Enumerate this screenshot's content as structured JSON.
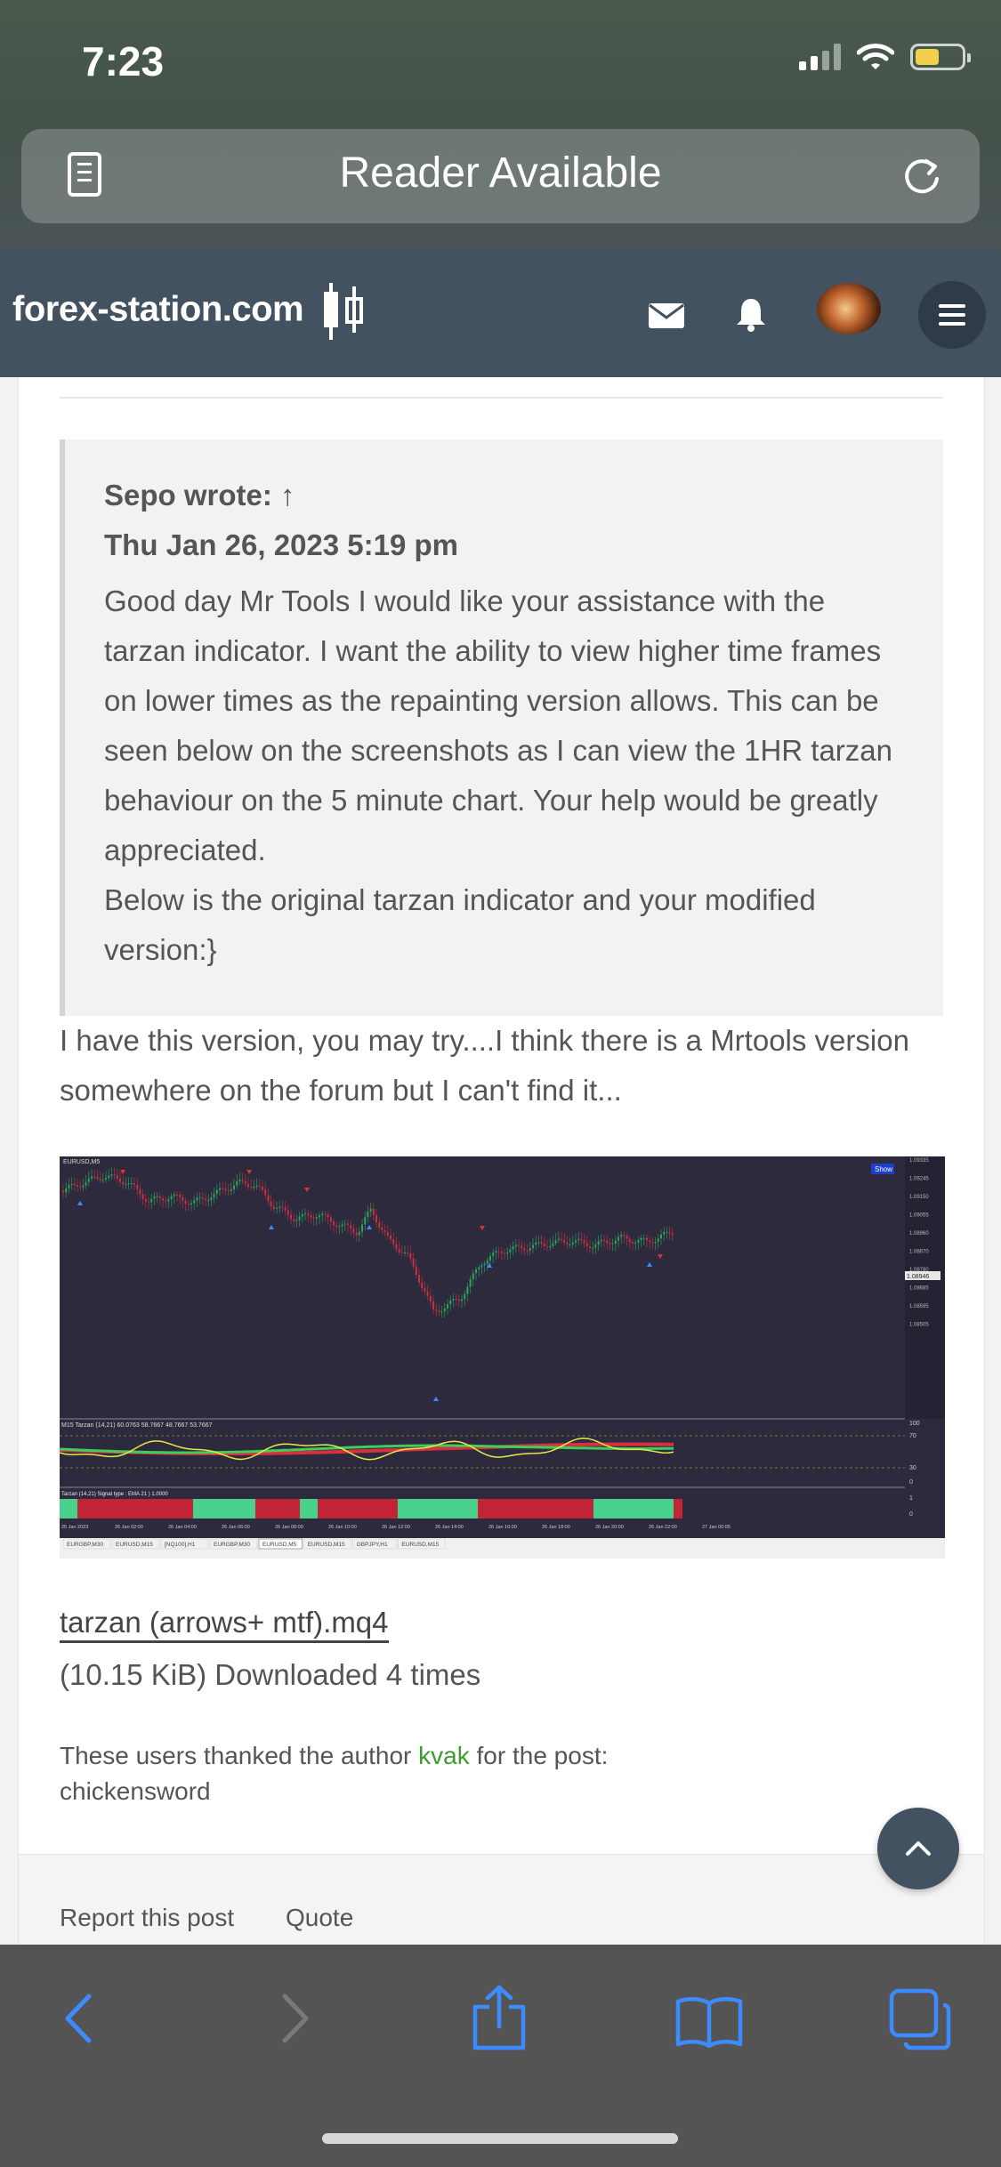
{
  "status_bar": {
    "time": "7:23"
  },
  "browser": {
    "address_text": "Reader Available"
  },
  "site_header": {
    "logo_text": "forex-station.com"
  },
  "post": {
    "quote": {
      "author_line": "Sepo wrote: ↑",
      "date": "Thu Jan 26, 2023 5:19 pm",
      "paragraph1": "Good day Mr Tools I would like your assistance with the tarzan indicator. I want the ability to view higher time frames on lower times as the repainting version allows. This can be seen below on the screenshots as I can view the 1HR tarzan behaviour on the 5 minute chart. Your help would be greatly appreciated.",
      "paragraph2": "Below is the original tarzan indicator and your modified version:}"
    },
    "reply_text": "I have this version, you may try....I think there is a Mrtools version somewhere on the forum but I can't find it...",
    "attachment": {
      "filename": "tarzan (arrows+ mtf).mq4",
      "info": "(10.15 KiB) Downloaded 4 times"
    },
    "thanks": {
      "prefix": "These users thanked the author ",
      "author": "kvak",
      "suffix": " for the post:",
      "users": "chickensword"
    },
    "actions": {
      "report": "Report this post",
      "quote": "Quote"
    }
  },
  "screenshot_chart": {
    "symbol_label": "EURUSD,M5",
    "show_button": "Show",
    "price_labels": [
      "1.09335",
      "1.09245",
      "1.09150",
      "1.09055",
      "1.08960",
      "1.08870",
      "1.08780",
      "1.08685",
      "1.08595",
      "1.08505"
    ],
    "current_price": "1.08946",
    "indicator_label": "M15 Tarzan (14,21) 60.0763 58.7667 48.7667 53.7667",
    "indicator_levels": [
      "100",
      "70",
      "30",
      "0"
    ],
    "histogram_label": "Tarzan (14,21) Signal type : EMA 21 ) 1.0000",
    "histogram_levels": [
      "1",
      "0"
    ],
    "time_labels": [
      "25 Jan 2023",
      "26 Jan 02:00",
      "26 Jan 04:00",
      "26 Jan 06:00",
      "26 Jan 08:00",
      "26 Jan 10:00",
      "26 Jan 12:00",
      "26 Jan 14:00",
      "26 Jan 16:00",
      "26 Jan 18:00",
      "26 Jan 20:00",
      "26 Jan 22:00",
      "27 Jan 00:05"
    ],
    "tabs": [
      "EURGBP,M30",
      "EURUSD,M15",
      "[NQ100],H1",
      "EURGBP,M30",
      "EURUSD,M5",
      "EURUSD,M15",
      "GBPJPY,H1",
      "EURUSD,M15"
    ],
    "active_tab": "EURUSD,M5",
    "colors": {
      "background": "#2d2a3e",
      "bull": "#2aa65a",
      "bear": "#c8303f",
      "signal_line": "#e8e84a",
      "histogram_bull": "#47d18a",
      "histogram_bear": "#c2243a"
    }
  },
  "icons": {
    "reader": "reader-icon",
    "reload": "reload-icon",
    "mail": "mail-icon",
    "bell": "bell-icon",
    "menu": "hamburger-icon",
    "scroll_top": "chevron-up-icon",
    "back": "back-icon",
    "forward": "forward-icon",
    "share": "share-icon",
    "bookmarks": "bookmarks-icon",
    "tabs": "tabs-icon"
  }
}
